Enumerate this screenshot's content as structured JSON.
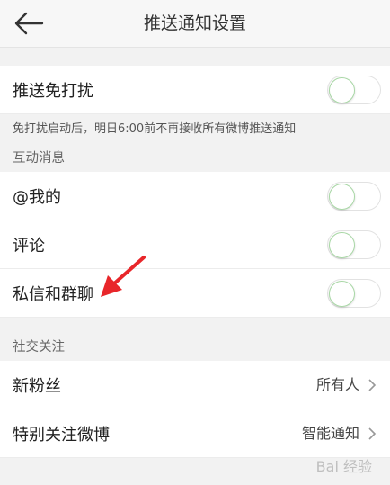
{
  "header": {
    "title": "推送通知设置",
    "back_icon": "arrow-left-icon"
  },
  "dnd": {
    "label": "推送免打扰",
    "enabled": false,
    "description": "免打扰启动后，明日6:00前不再接收所有微博推送通知"
  },
  "interaction": {
    "section_title": "互动消息",
    "items": [
      {
        "label": "@我的",
        "enabled": false
      },
      {
        "label": "评论",
        "enabled": false
      },
      {
        "label": "私信和群聊",
        "enabled": false
      }
    ]
  },
  "social": {
    "section_title": "社交关注",
    "items": [
      {
        "label": "新粉丝",
        "value": "所有人"
      },
      {
        "label": "特别关注微博",
        "value": "智能通知"
      }
    ]
  },
  "annotation": {
    "arrow_color": "#e8262a",
    "target": "私信和群聊"
  },
  "watermark": {
    "text": "Bai 经验"
  }
}
